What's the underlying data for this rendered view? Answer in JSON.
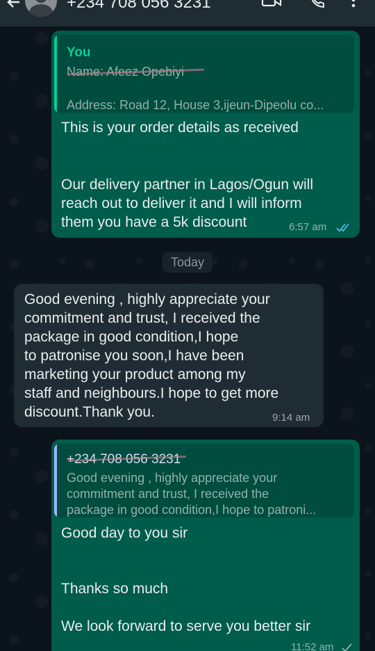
{
  "header": {
    "contact_title": "+234 708 056 3231"
  },
  "messages": {
    "m1": {
      "quote_author": "You",
      "quote_line1": "Name: Afeez Opebiyi",
      "quote_line2": "Address: Road 12, House 3,ijeun-Dipeolu co...",
      "line1": "This is your order details as received",
      "line2": "Our delivery partner in Lagos/Ogun will",
      "line3": "reach out to deliver it and I will inform",
      "line4": "them you have a 5k discount",
      "time": "6:57 am"
    },
    "day_separator": "Today",
    "m2": {
      "line1": "Good evening , highly appreciate your",
      "line2": "commitment and trust, I received the",
      "line3": "package in good condition,I hope",
      "line4": "to patronise you soon,I have been",
      "line5": "marketing your product among my",
      "line6": "staff and neighbours.I hope to get more",
      "line7": "discount.Thank you.",
      "time": "9:14 am"
    },
    "m3": {
      "quote_author": "+234 708 056 3231",
      "quote_line1": "Good evening , highly appreciate your",
      "quote_line2": "commitment and trust, I received the",
      "quote_line3": "package in good condition,I hope to patroni...",
      "line1": "Good day to you sir",
      "line2": "Thanks so much",
      "line3": "We look forward to serve you better sir",
      "time": "11:52 am"
    }
  },
  "colors": {
    "outgoing_bubble": "#005c4b",
    "incoming_bubble": "#202c33",
    "read_ticks": "#53bdeb",
    "quote_bar_self": "#06cf9c",
    "quote_bar_contact": "#a5b1ff"
  },
  "icons": [
    "back-arrow-icon",
    "avatar",
    "video-call-icon",
    "voice-call-icon",
    "more-options-icon",
    "double-check-icon"
  ]
}
